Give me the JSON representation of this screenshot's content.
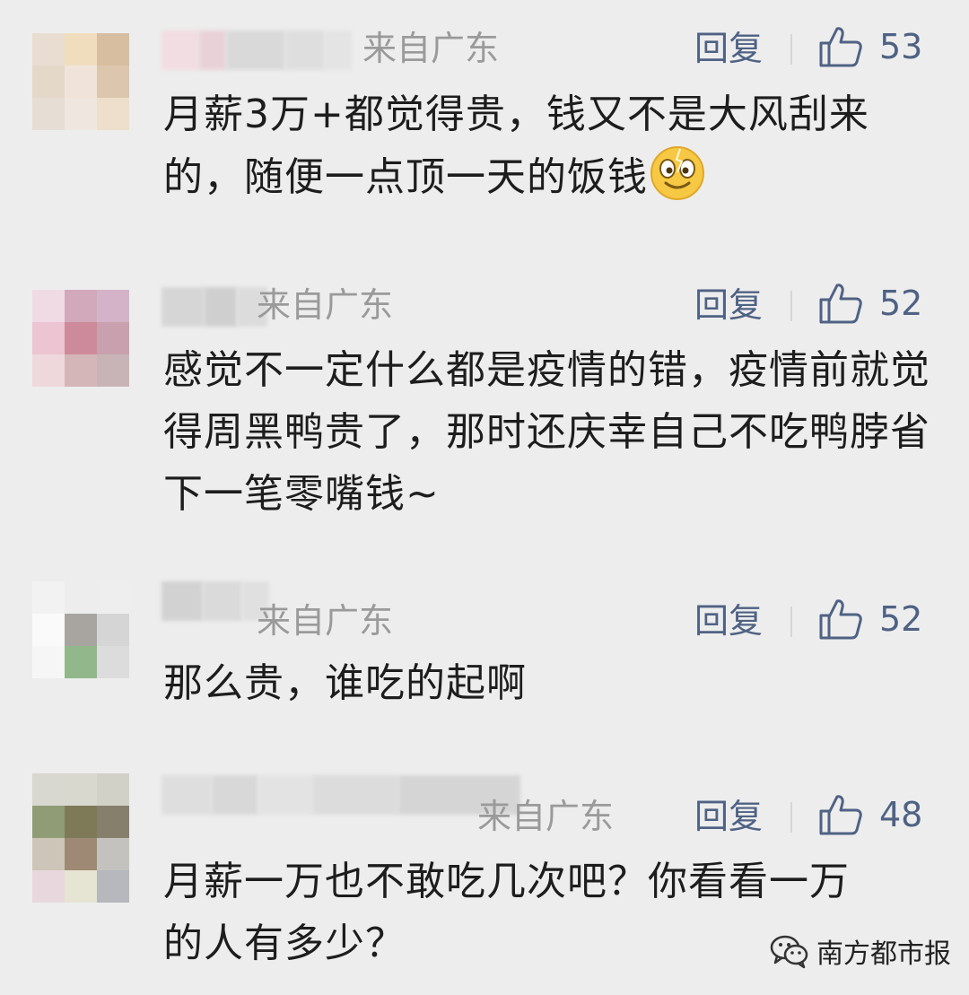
{
  "comments": [
    {
      "location": "来自广东",
      "reply_label": "回复",
      "likes": "53",
      "text": "月薪3万+都觉得贵，钱又不是大风刮来的，随便一点顶一天的饭钱",
      "emoji": "smiling-face-emoji",
      "avatar_colors": [
        "#e9ddd2",
        "#efddbd",
        "#d8bea0",
        "#e4d8c8",
        "#f0e4da",
        "#dcc6ad",
        "#e6ded5",
        "#efe6df",
        "#eedecc"
      ],
      "name_colors": [
        "#f2dde2",
        "#e8d2d8",
        "#d9d9d9",
        "#dedede",
        "#e4e4e4"
      ]
    },
    {
      "location": "来自广东",
      "reply_label": "回复",
      "likes": "52",
      "text": "感觉不一定什么都是疫情的错，疫情前就觉得周黑鸭贵了，那时还庆幸自己不吃鸭脖省下一笔零嘴钱~",
      "avatar_colors": [
        "#f0dbe4",
        "#d2a9bb",
        "#d4b3c8",
        "#ecc4d2",
        "#cd8a9a",
        "#c9a0ae",
        "#efd8dc",
        "#d4b5b8",
        "#c8b4b6"
      ],
      "name_colors": [
        "#d6d6d6",
        "#cfcfcf",
        "#dcdcdc"
      ]
    },
    {
      "location": "来自广东",
      "reply_label": "回复",
      "likes": "52",
      "text": "那么贵，谁吃的起啊",
      "avatar_colors": [
        "#f2f2f2",
        "#ededed",
        "#eeeeee",
        "#fafafa",
        "#a8a5a1",
        "#d5d5d5",
        "#f6f6f6",
        "#92b78b",
        "#dcdcdc"
      ],
      "name_colors": [
        "#d2d2d2",
        "#dadada",
        "#e0e0e0"
      ]
    },
    {
      "location": "来自广东",
      "reply_label": "回复",
      "likes": "48",
      "text": "月薪一万也不敢吃几次吧？你看看一万的人有多少？",
      "avatar_colors": [
        "#d8d7d0",
        "#d8d8cf",
        "#d1d1c8",
        "#8f9c76",
        "#7e7a58",
        "#867f6c",
        "#cdc5b8",
        "#9e8a74",
        "#c3c2be",
        "#e8d8dd",
        "#e6e4d2",
        "#b6b8bd"
      ],
      "name_colors": [
        "#dedede",
        "#d8d8d8",
        "#e3e3e3",
        "#dcdcdc",
        "#d5d5d5"
      ]
    }
  ],
  "watermark": {
    "icon": "wechat-icon",
    "text": "南方都市报"
  },
  "colors": {
    "background": "#ededed",
    "link": "#4f6284",
    "location": "#9a9a9a",
    "text": "#1d1d1d"
  }
}
